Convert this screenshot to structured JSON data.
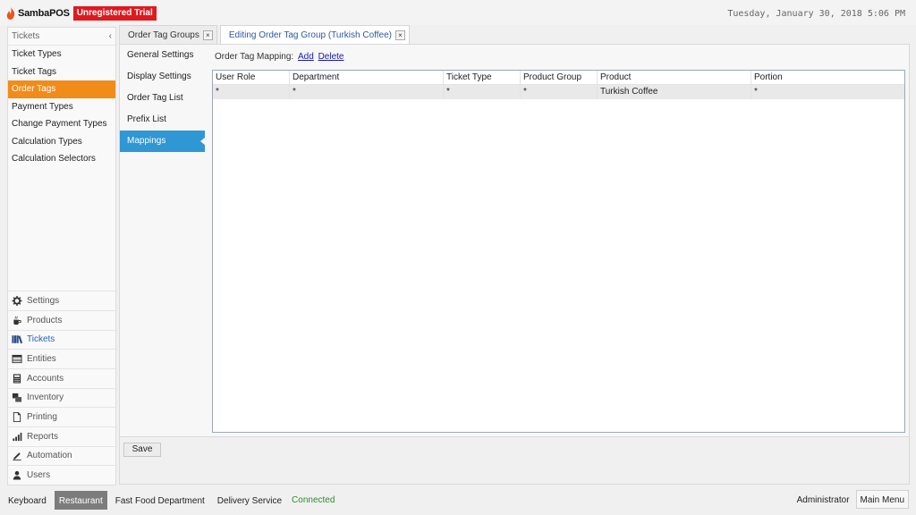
{
  "app": {
    "name": "SambaPOS",
    "trial_label": "Unregistered Trial",
    "clock": "Tuesday, January 30, 2018 5:06 PM"
  },
  "leftnav": {
    "header": "Tickets",
    "collapse_glyph": "‹",
    "items": [
      {
        "label": "Ticket Types"
      },
      {
        "label": "Ticket Tags"
      },
      {
        "label": "Order Tags",
        "active": true
      },
      {
        "label": "Payment Types"
      },
      {
        "label": "Change Payment Types"
      },
      {
        "label": "Calculation Types"
      },
      {
        "label": "Calculation Selectors"
      }
    ],
    "modules": [
      {
        "label": "Settings",
        "icon": "gear-icon"
      },
      {
        "label": "Products",
        "icon": "cup-icon"
      },
      {
        "label": "Tickets",
        "icon": "books-icon",
        "active": true
      },
      {
        "label": "Entities",
        "icon": "table-icon"
      },
      {
        "label": "Accounts",
        "icon": "calculator-icon"
      },
      {
        "label": "Inventory",
        "icon": "boxes-icon"
      },
      {
        "label": "Printing",
        "icon": "document-icon"
      },
      {
        "label": "Reports",
        "icon": "bar-chart-icon"
      },
      {
        "label": "Automation",
        "icon": "pen-icon"
      },
      {
        "label": "Users",
        "icon": "user-icon"
      }
    ]
  },
  "tabs": [
    {
      "label": "Order Tag Groups",
      "close": "×"
    },
    {
      "label": "Editing Order Tag Group (Turkish Coffee)",
      "close": "×",
      "active": true
    }
  ],
  "editor": {
    "side_menu": [
      {
        "label": "General Settings"
      },
      {
        "label": "Display Settings"
      },
      {
        "label": "Order Tag List"
      },
      {
        "label": "Prefix List"
      },
      {
        "label": "Mappings",
        "active": true
      }
    ],
    "mapping_label": "Order Tag Mapping:",
    "add_link": "Add",
    "delete_link": "Delete",
    "columns": [
      "User Role",
      "Department",
      "Ticket Type",
      "Product Group",
      "Product",
      "Portion"
    ],
    "rows": [
      [
        "*",
        "*",
        "*",
        "*",
        "Turkish Coffee",
        "*"
      ]
    ],
    "save_label": "Save"
  },
  "statusbar": {
    "keyboard": "Keyboard",
    "restaurant": "Restaurant",
    "fast_food": "Fast Food Department",
    "delivery": "Delivery Service",
    "connection": "Connected",
    "user": "Administrator",
    "main_menu": "Main Menu"
  },
  "colors": {
    "accent_orange": "#f18b1a",
    "accent_blue": "#2e97d4",
    "trial_red": "#e0191f",
    "connected_green": "#2e8b2e"
  }
}
